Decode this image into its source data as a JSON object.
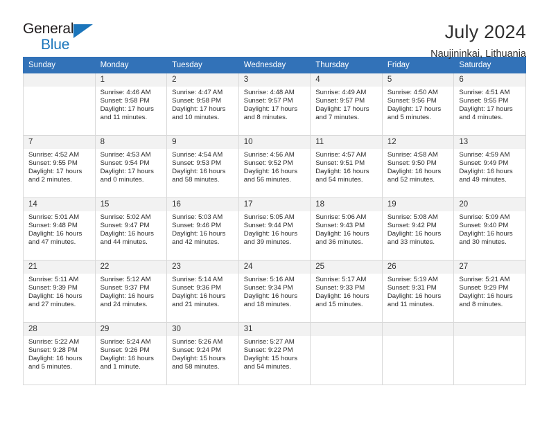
{
  "brand": {
    "name_part1": "General",
    "name_part2": "Blue",
    "triangle_icon": "triangle-icon",
    "accent_color": "#1b75bb"
  },
  "header": {
    "title": "July 2024",
    "subtitle": "Naujininkai, Lithuania"
  },
  "calendar": {
    "header_bg": "#3272b8",
    "daynum_bg": "#f2f2f2",
    "weekdays": [
      "Sunday",
      "Monday",
      "Tuesday",
      "Wednesday",
      "Thursday",
      "Friday",
      "Saturday"
    ],
    "weeks": [
      [
        {
          "day": "",
          "sunrise": "",
          "sunset": "",
          "daylight": ""
        },
        {
          "day": "1",
          "sunrise": "Sunrise: 4:46 AM",
          "sunset": "Sunset: 9:58 PM",
          "daylight": "Daylight: 17 hours and 11 minutes."
        },
        {
          "day": "2",
          "sunrise": "Sunrise: 4:47 AM",
          "sunset": "Sunset: 9:58 PM",
          "daylight": "Daylight: 17 hours and 10 minutes."
        },
        {
          "day": "3",
          "sunrise": "Sunrise: 4:48 AM",
          "sunset": "Sunset: 9:57 PM",
          "daylight": "Daylight: 17 hours and 8 minutes."
        },
        {
          "day": "4",
          "sunrise": "Sunrise: 4:49 AM",
          "sunset": "Sunset: 9:57 PM",
          "daylight": "Daylight: 17 hours and 7 minutes."
        },
        {
          "day": "5",
          "sunrise": "Sunrise: 4:50 AM",
          "sunset": "Sunset: 9:56 PM",
          "daylight": "Daylight: 17 hours and 5 minutes."
        },
        {
          "day": "6",
          "sunrise": "Sunrise: 4:51 AM",
          "sunset": "Sunset: 9:55 PM",
          "daylight": "Daylight: 17 hours and 4 minutes."
        }
      ],
      [
        {
          "day": "7",
          "sunrise": "Sunrise: 4:52 AM",
          "sunset": "Sunset: 9:55 PM",
          "daylight": "Daylight: 17 hours and 2 minutes."
        },
        {
          "day": "8",
          "sunrise": "Sunrise: 4:53 AM",
          "sunset": "Sunset: 9:54 PM",
          "daylight": "Daylight: 17 hours and 0 minutes."
        },
        {
          "day": "9",
          "sunrise": "Sunrise: 4:54 AM",
          "sunset": "Sunset: 9:53 PM",
          "daylight": "Daylight: 16 hours and 58 minutes."
        },
        {
          "day": "10",
          "sunrise": "Sunrise: 4:56 AM",
          "sunset": "Sunset: 9:52 PM",
          "daylight": "Daylight: 16 hours and 56 minutes."
        },
        {
          "day": "11",
          "sunrise": "Sunrise: 4:57 AM",
          "sunset": "Sunset: 9:51 PM",
          "daylight": "Daylight: 16 hours and 54 minutes."
        },
        {
          "day": "12",
          "sunrise": "Sunrise: 4:58 AM",
          "sunset": "Sunset: 9:50 PM",
          "daylight": "Daylight: 16 hours and 52 minutes."
        },
        {
          "day": "13",
          "sunrise": "Sunrise: 4:59 AM",
          "sunset": "Sunset: 9:49 PM",
          "daylight": "Daylight: 16 hours and 49 minutes."
        }
      ],
      [
        {
          "day": "14",
          "sunrise": "Sunrise: 5:01 AM",
          "sunset": "Sunset: 9:48 PM",
          "daylight": "Daylight: 16 hours and 47 minutes."
        },
        {
          "day": "15",
          "sunrise": "Sunrise: 5:02 AM",
          "sunset": "Sunset: 9:47 PM",
          "daylight": "Daylight: 16 hours and 44 minutes."
        },
        {
          "day": "16",
          "sunrise": "Sunrise: 5:03 AM",
          "sunset": "Sunset: 9:46 PM",
          "daylight": "Daylight: 16 hours and 42 minutes."
        },
        {
          "day": "17",
          "sunrise": "Sunrise: 5:05 AM",
          "sunset": "Sunset: 9:44 PM",
          "daylight": "Daylight: 16 hours and 39 minutes."
        },
        {
          "day": "18",
          "sunrise": "Sunrise: 5:06 AM",
          "sunset": "Sunset: 9:43 PM",
          "daylight": "Daylight: 16 hours and 36 minutes."
        },
        {
          "day": "19",
          "sunrise": "Sunrise: 5:08 AM",
          "sunset": "Sunset: 9:42 PM",
          "daylight": "Daylight: 16 hours and 33 minutes."
        },
        {
          "day": "20",
          "sunrise": "Sunrise: 5:09 AM",
          "sunset": "Sunset: 9:40 PM",
          "daylight": "Daylight: 16 hours and 30 minutes."
        }
      ],
      [
        {
          "day": "21",
          "sunrise": "Sunrise: 5:11 AM",
          "sunset": "Sunset: 9:39 PM",
          "daylight": "Daylight: 16 hours and 27 minutes."
        },
        {
          "day": "22",
          "sunrise": "Sunrise: 5:12 AM",
          "sunset": "Sunset: 9:37 PM",
          "daylight": "Daylight: 16 hours and 24 minutes."
        },
        {
          "day": "23",
          "sunrise": "Sunrise: 5:14 AM",
          "sunset": "Sunset: 9:36 PM",
          "daylight": "Daylight: 16 hours and 21 minutes."
        },
        {
          "day": "24",
          "sunrise": "Sunrise: 5:16 AM",
          "sunset": "Sunset: 9:34 PM",
          "daylight": "Daylight: 16 hours and 18 minutes."
        },
        {
          "day": "25",
          "sunrise": "Sunrise: 5:17 AM",
          "sunset": "Sunset: 9:33 PM",
          "daylight": "Daylight: 16 hours and 15 minutes."
        },
        {
          "day": "26",
          "sunrise": "Sunrise: 5:19 AM",
          "sunset": "Sunset: 9:31 PM",
          "daylight": "Daylight: 16 hours and 11 minutes."
        },
        {
          "day": "27",
          "sunrise": "Sunrise: 5:21 AM",
          "sunset": "Sunset: 9:29 PM",
          "daylight": "Daylight: 16 hours and 8 minutes."
        }
      ],
      [
        {
          "day": "28",
          "sunrise": "Sunrise: 5:22 AM",
          "sunset": "Sunset: 9:28 PM",
          "daylight": "Daylight: 16 hours and 5 minutes."
        },
        {
          "day": "29",
          "sunrise": "Sunrise: 5:24 AM",
          "sunset": "Sunset: 9:26 PM",
          "daylight": "Daylight: 16 hours and 1 minute."
        },
        {
          "day": "30",
          "sunrise": "Sunrise: 5:26 AM",
          "sunset": "Sunset: 9:24 PM",
          "daylight": "Daylight: 15 hours and 58 minutes."
        },
        {
          "day": "31",
          "sunrise": "Sunrise: 5:27 AM",
          "sunset": "Sunset: 9:22 PM",
          "daylight": "Daylight: 15 hours and 54 minutes."
        },
        {
          "day": "",
          "sunrise": "",
          "sunset": "",
          "daylight": ""
        },
        {
          "day": "",
          "sunrise": "",
          "sunset": "",
          "daylight": ""
        },
        {
          "day": "",
          "sunrise": "",
          "sunset": "",
          "daylight": ""
        }
      ]
    ]
  }
}
